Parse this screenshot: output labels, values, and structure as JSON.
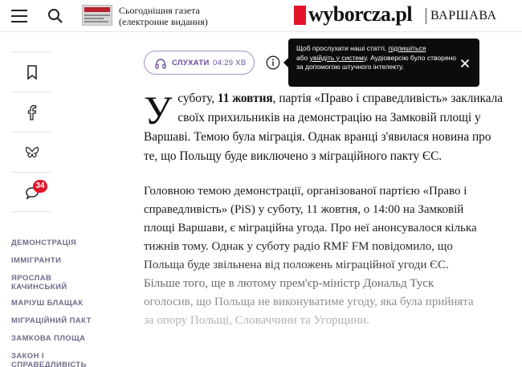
{
  "header": {
    "newspaper_line1": "Сьогоднішня газета",
    "newspaper_line2": "(електронне видання)",
    "logo": "wyborcza.pl",
    "city": "ВАРШАВА"
  },
  "sidebar": {
    "comments_count": "34",
    "tags": [
      "ДЕМОНСТРАЦІЯ",
      "ІММІГРАНТИ",
      "ЯРОСЛАВ КАЧИНСЬКИЙ",
      "МАРІУШ БЛАЩАК",
      "МІГРАЦІЙНИЙ ПАКТ",
      "ЗАМКОВА ПЛОЩА",
      "ЗАКОН І СПРАВЕДЛИВІСТЬ"
    ]
  },
  "listen": {
    "label": "СЛУХАТИ",
    "duration": "04:29 ХВ"
  },
  "tooltip": {
    "t1": "Щоб прослухати наші статті, ",
    "link1": "підпишіться",
    "t2": "або ",
    "link2": "увійдіть у систему",
    "t3": ". Аудіоверсію було створено за допомогою штучного інтелекту."
  },
  "article": {
    "dropcap": "У",
    "p1_a": " суботу, ",
    "p1_b": "11 жовтня",
    "p1_c": ", партія «Право і справедливість» закликала своїх прихильників на демонстрацію на Замковій площі у Варшаві. Темою була міграція. Однак вранці з'явилася новина про те, що Польщу буде виключено з міграційного пакту ЄС.",
    "p2_lines": [
      "Головною темою демонстрації, організованої партією «Право і",
      "справедливість» (PiS) у суботу, 11 жовтня, о 14:00 на Замковій",
      "площі Варшави, є міграційна угода. Про неї анонсувалося кілька",
      "тижнів тому. Однак у суботу радіо RMF FM повідомило, що",
      "Польща буде звільнена від положень міграційної угоди ЄС.",
      "Більше того, ще в лютому прем'єр-міністр Дональд Туск",
      "оголосив, що Польща не виконуватиме угоду, яка була прийнята",
      "за опору Польщі, Словаччини та Угорщини."
    ],
    "p2_colors": [
      "#1a1a1a",
      "#1a1a1a",
      "#1f1f1f",
      "#2a2a2a",
      "#3d3d3d",
      "#6a6a6a",
      "#8e8e8e",
      "#b3b3b3"
    ]
  }
}
